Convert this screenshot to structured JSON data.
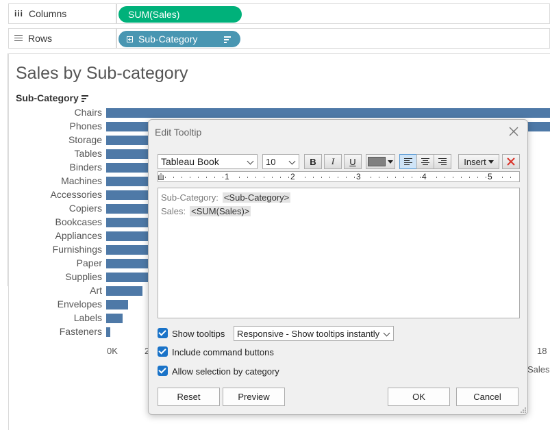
{
  "shelves": {
    "columns": {
      "label": "Columns",
      "pill": "SUM(Sales)"
    },
    "rows": {
      "label": "Rows",
      "pill": "Sub-Category"
    }
  },
  "sheet": {
    "title": "Sales by Sub-category",
    "header": "Sub-Category",
    "axis_label": "Sales",
    "axis_ticks": [
      "0K",
      "2",
      "18"
    ]
  },
  "chart_data": {
    "type": "bar",
    "title": "Sales by Sub-category",
    "orientation": "horizontal",
    "categories": [
      "Chairs",
      "Phones",
      "Storage",
      "Tables",
      "Binders",
      "Machines",
      "Accessories",
      "Copiers",
      "Bookcases",
      "Appliances",
      "Furnishings",
      "Paper",
      "Supplies",
      "Art",
      "Envelopes",
      "Labels",
      "Fasteners"
    ],
    "values": [
      328000,
      330000,
      224000,
      207000,
      203000,
      189000,
      167000,
      150000,
      115000,
      108000,
      92000,
      78000,
      47000,
      27000,
      16000,
      12000,
      3000
    ],
    "xlabel": "Sales",
    "ylabel": "Sub-Category",
    "bar_color": "#4e79a7"
  },
  "dialog": {
    "title": "Edit Tooltip",
    "font_name": "Tableau Book",
    "font_size": "10",
    "bold": "B",
    "italic": "I",
    "underline": "U",
    "insert": "Insert",
    "ruler_numbers": [
      "1",
      "2",
      "3",
      "4",
      "5"
    ],
    "line1_label": "Sub-Category:",
    "line1_field": "<Sub-Category>",
    "line2_label": "Sales:",
    "line2_field": "<SUM(Sales)>",
    "show_tooltips": "Show tooltips",
    "tooltip_mode": "Responsive - Show tooltips instantly",
    "include_buttons": "Include command buttons",
    "allow_selection": "Allow selection by category",
    "reset": "Reset",
    "preview": "Preview",
    "ok": "OK",
    "cancel": "Cancel"
  }
}
